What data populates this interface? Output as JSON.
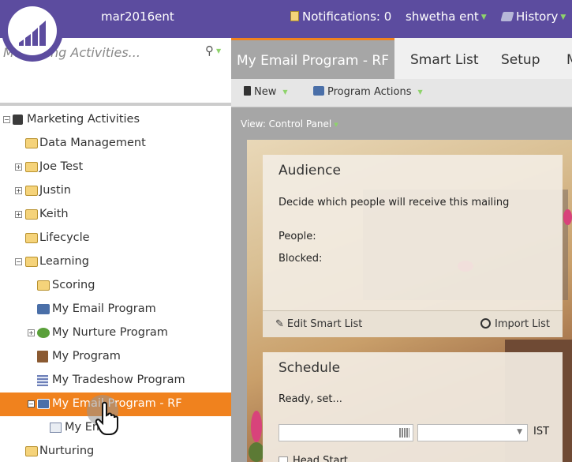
{
  "header": {
    "subscription": "mar2016ent",
    "notifications": "Notifications: 0",
    "user": "shwetha ent",
    "history": "History"
  },
  "sidebar": {
    "search_placeholder": "Marketing Activities...",
    "tree": [
      {
        "label": "Marketing Activities"
      },
      {
        "label": "Data Management"
      },
      {
        "label": "Joe Test"
      },
      {
        "label": "Justin"
      },
      {
        "label": "Keith"
      },
      {
        "label": "Lifecycle"
      },
      {
        "label": "Learning"
      },
      {
        "label": "Scoring"
      },
      {
        "label": "My Email Program"
      },
      {
        "label": "My Nurture Program"
      },
      {
        "label": "My Program"
      },
      {
        "label": "My Tradeshow Program"
      },
      {
        "label": "My Email Program - RF"
      },
      {
        "label": "My Em"
      },
      {
        "label": "Nurturing"
      }
    ]
  },
  "tabs": [
    {
      "label": "My Email Program - RF"
    },
    {
      "label": "Smart List"
    },
    {
      "label": "Setup"
    },
    {
      "label": "M"
    }
  ],
  "toolbar": {
    "new_label": "New",
    "program_actions_label": "Program Actions"
  },
  "view_label": "View: Control Panel",
  "audience": {
    "title": "Audience",
    "description": "Decide which people will receive this mailing",
    "people_label": "People:",
    "blocked_label": "Blocked:",
    "edit_label": "Edit Smart List",
    "import_label": "Import List"
  },
  "schedule": {
    "title": "Schedule",
    "status": "Ready, set...",
    "timezone": "IST",
    "head_start": "Head Start"
  },
  "colors": {
    "header_bg": "#5c4c9f",
    "selected_bg": "#f0821e",
    "accent_green": "#8ed36b"
  }
}
